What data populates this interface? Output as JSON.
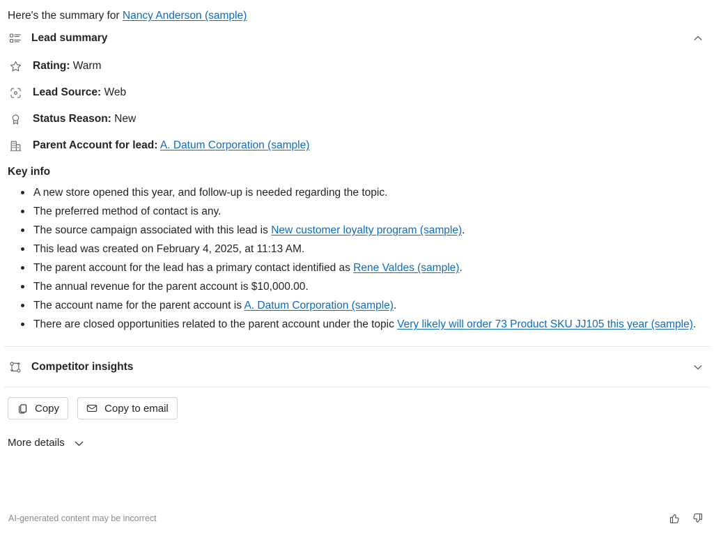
{
  "intro": {
    "prefix": "Here's the summary for ",
    "subject_link": "Nancy Anderson (sample)"
  },
  "lead_summary": {
    "title": "Lead summary",
    "icon": "list-icon",
    "collapse_icon": "chevron-up-icon",
    "fields": [
      {
        "icon": "star-icon",
        "label": "Rating:",
        "value": "Warm",
        "is_link": false
      },
      {
        "icon": "scan-icon",
        "label": "Lead Source:",
        "value": "Web",
        "is_link": false
      },
      {
        "icon": "ribbon-icon",
        "label": "Status Reason:",
        "value": "New",
        "is_link": false
      },
      {
        "icon": "building-icon",
        "label": "Parent Account for lead:",
        "value": "A. Datum Corporation (sample)",
        "is_link": true
      }
    ]
  },
  "key_info": {
    "title": "Key info",
    "bullets": [
      {
        "segments": [
          {
            "text": "A new store opened this year, and follow-up is needed regarding the topic.",
            "link": false
          }
        ]
      },
      {
        "segments": [
          {
            "text": "The preferred method of contact is any.",
            "link": false
          }
        ]
      },
      {
        "segments": [
          {
            "text": "The source campaign associated with this lead is ",
            "link": false
          },
          {
            "text": "New customer loyalty program (sample)",
            "link": true
          },
          {
            "text": ".",
            "link": false
          }
        ]
      },
      {
        "segments": [
          {
            "text": "This lead was created on February 4, 2025, at 11:13 AM.",
            "link": false
          }
        ]
      },
      {
        "segments": [
          {
            "text": "The parent account for the lead has a primary contact identified as ",
            "link": false
          },
          {
            "text": "Rene Valdes (sample)",
            "link": true
          },
          {
            "text": ".",
            "link": false
          }
        ]
      },
      {
        "segments": [
          {
            "text": "The annual revenue for the parent account is $10,000.00.",
            "link": false
          }
        ]
      },
      {
        "segments": [
          {
            "text": "The account name for the parent account is ",
            "link": false
          },
          {
            "text": "A. Datum Corporation (sample)",
            "link": true
          },
          {
            "text": ".",
            "link": false
          }
        ]
      },
      {
        "segments": [
          {
            "text": "There are closed opportunities related to the parent account under the topic ",
            "link": false
          },
          {
            "text": "Very likely will order 73 Product SKU JJ105 this year (sample)",
            "link": true
          },
          {
            "text": ".",
            "link": false
          }
        ]
      }
    ]
  },
  "competitor_insights": {
    "title": "Competitor insights",
    "icon": "branch-swap-icon",
    "expand_icon": "chevron-down-icon"
  },
  "actions": {
    "copy_label": "Copy",
    "copy_icon": "copy-icon",
    "copy_to_email_label": "Copy to email",
    "copy_to_email_icon": "mail-icon"
  },
  "more_details": {
    "label": "More details",
    "icon": "chevron-down-icon"
  },
  "footer": {
    "disclaimer": "AI-generated content may be incorrect",
    "thumbs_up_icon": "thumbs-up-icon",
    "thumbs_down_icon": "thumbs-down-icon"
  },
  "colors": {
    "link": "#0f6cbd",
    "text": "#242424",
    "muted": "#8a8a8a",
    "divider": "#e6e6e6",
    "icon": "#616161"
  }
}
